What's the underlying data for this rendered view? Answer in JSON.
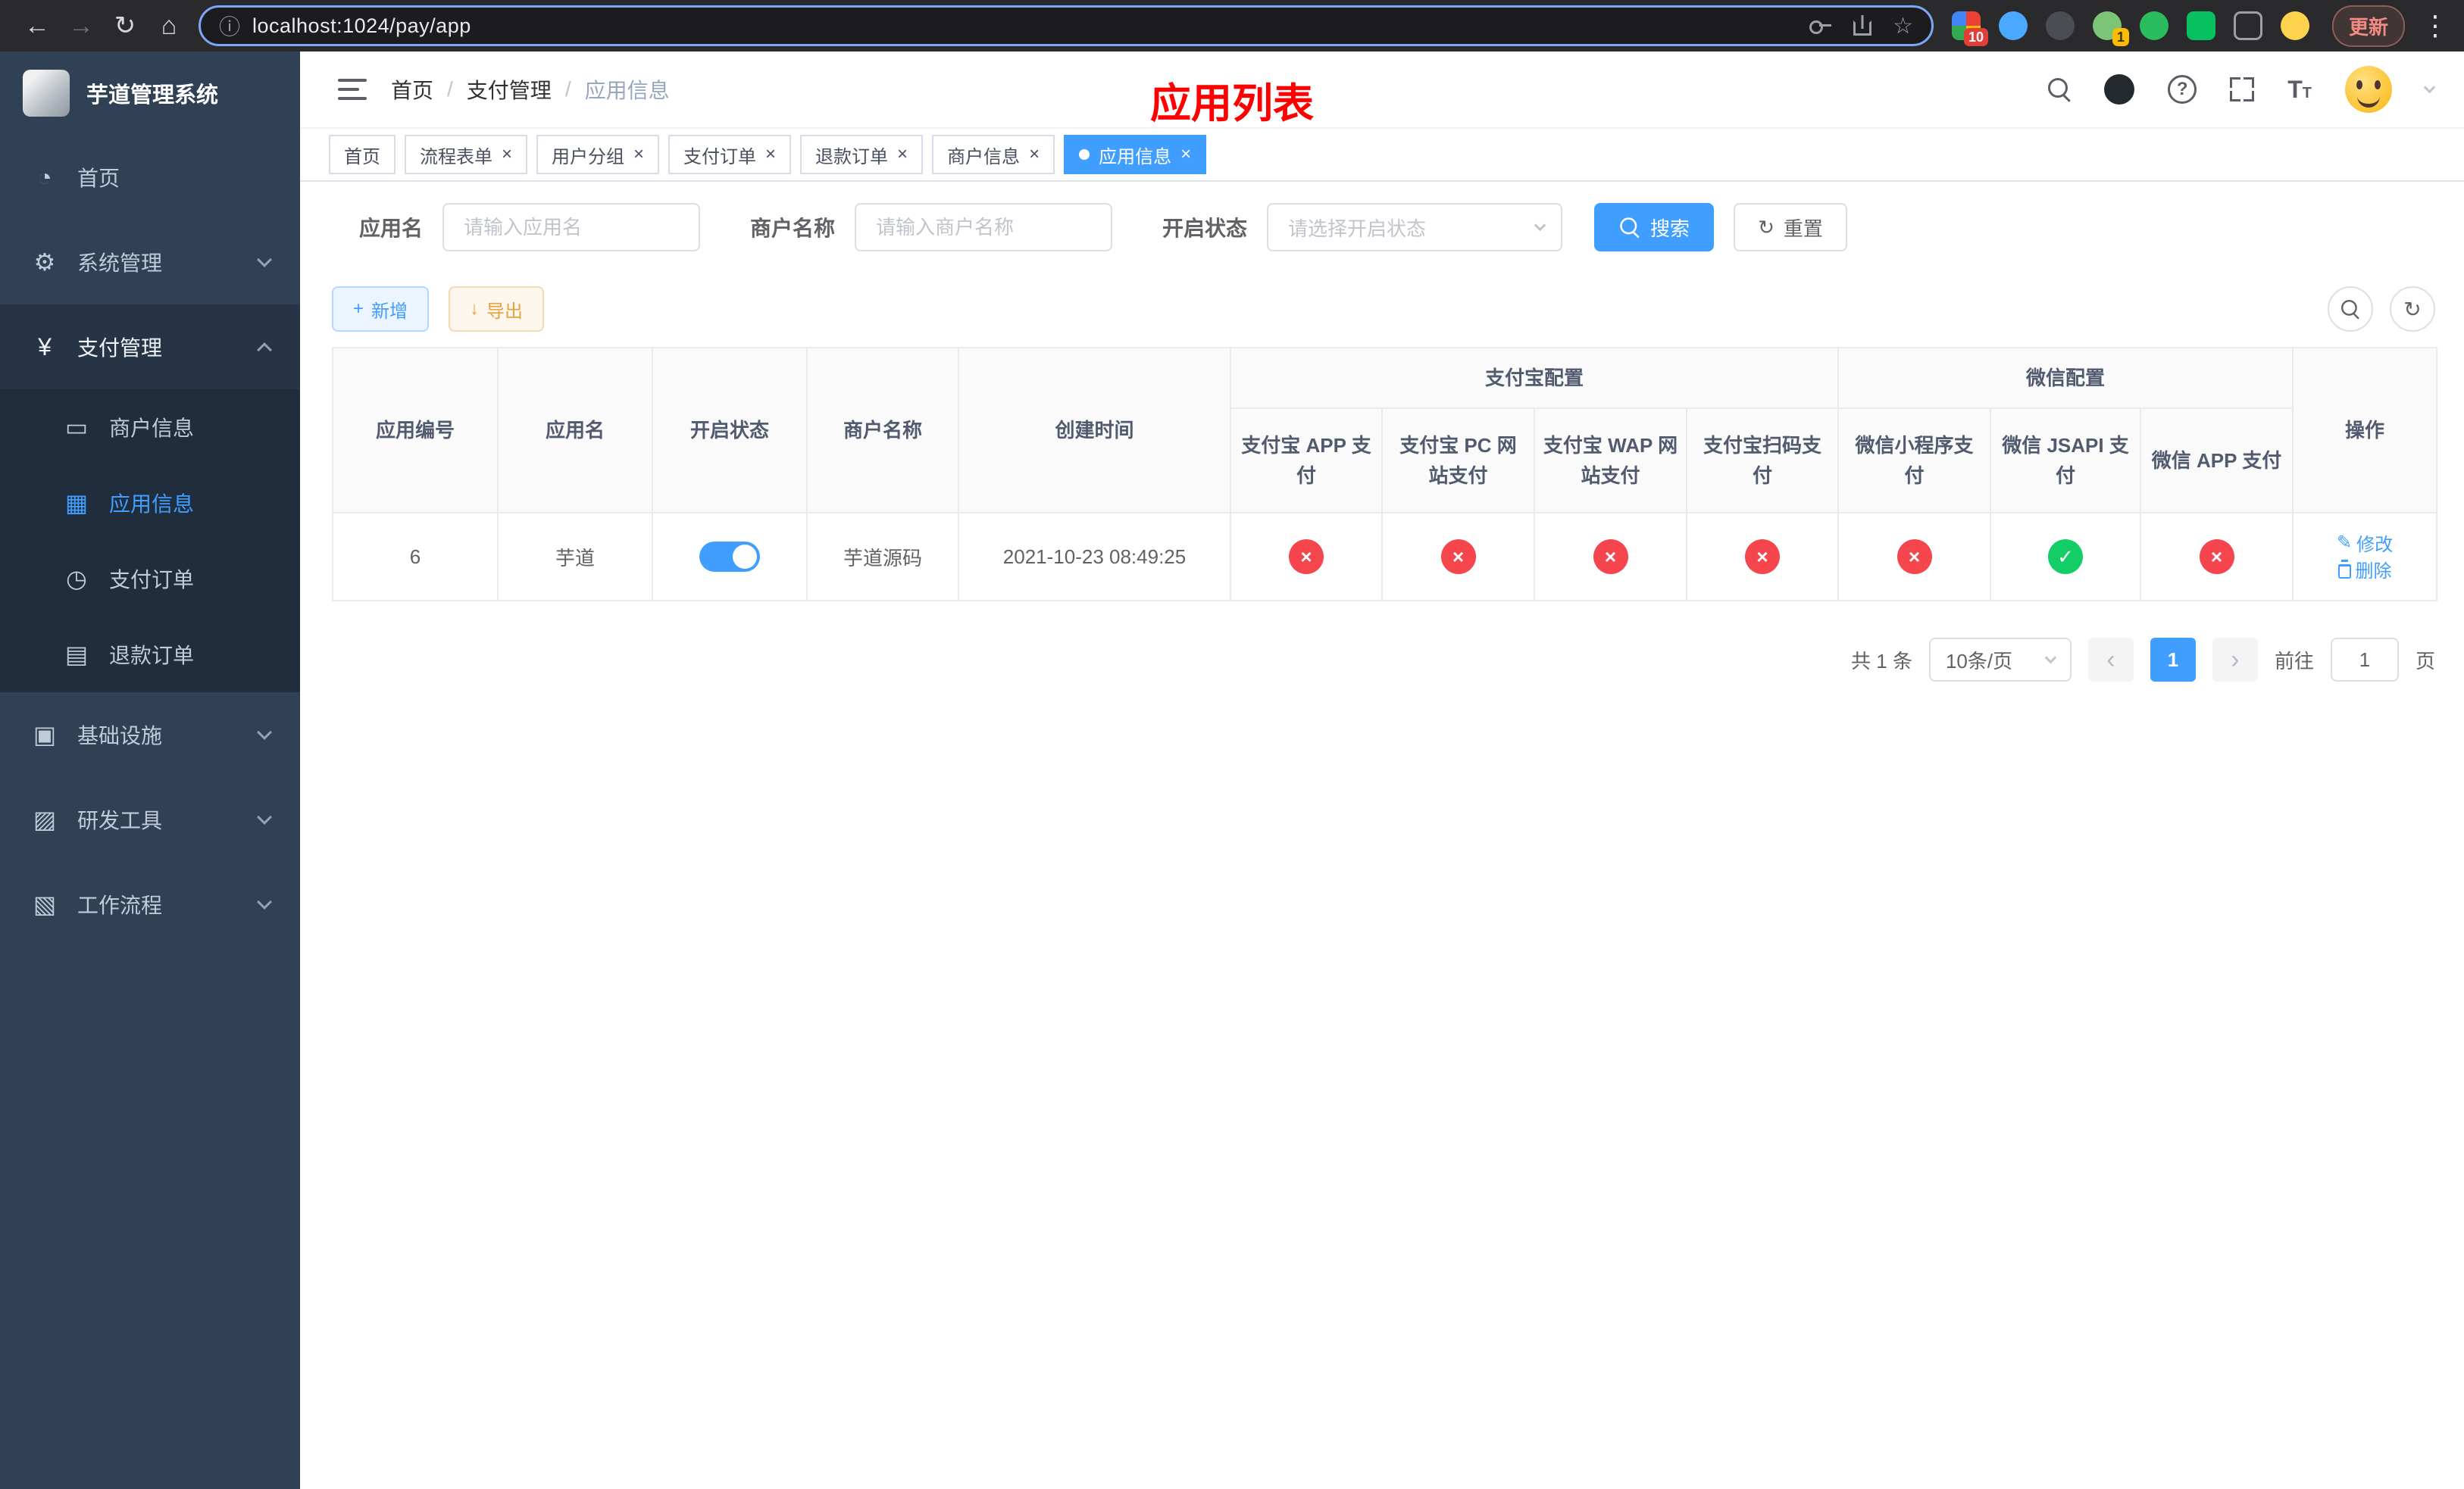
{
  "browser": {
    "url": "localhost:1024/pay/app",
    "update_label": "更新",
    "extension_badges": {
      "grid": "10",
      "avatar": "1"
    }
  },
  "icons": {
    "back": "←",
    "forward": "→",
    "reload": "↻",
    "home": "⌂",
    "site_info": "ⓘ",
    "star": "☆",
    "more": "⋮",
    "close": "×",
    "cross": "×",
    "check": "✓",
    "plus": "+",
    "download": "↓",
    "refresh": "↻",
    "question": "?",
    "edit": "✎",
    "prev": "‹",
    "next": "›",
    "font_size": "T",
    "dashboard": "◔",
    "gear": "⚙",
    "yen": "¥",
    "card": "▭",
    "grid": "▦",
    "order": "◷",
    "refund": "▤",
    "infra": "▣",
    "tools": "▨",
    "flow": "▧"
  },
  "sidebar": {
    "app_title": "芋道管理系统",
    "items": {
      "home": "首页",
      "system": "系统管理",
      "payment": "支付管理",
      "infra": "基础设施",
      "dev_tools": "研发工具",
      "workflow": "工作流程"
    },
    "payment_children": {
      "merchant": "商户信息",
      "app_info": "应用信息",
      "pay_order": "支付订单",
      "refund_order": "退款订单"
    }
  },
  "header": {
    "breadcrumb": {
      "home": "首页",
      "payment": "支付管理",
      "current": "应用信息",
      "separator": "/"
    },
    "overlay_title": "应用列表"
  },
  "tabs": [
    {
      "label": "首页",
      "closable": false,
      "active": false
    },
    {
      "label": "流程表单",
      "closable": true,
      "active": false
    },
    {
      "label": "用户分组",
      "closable": true,
      "active": false
    },
    {
      "label": "支付订单",
      "closable": true,
      "active": false
    },
    {
      "label": "退款订单",
      "closable": true,
      "active": false
    },
    {
      "label": "商户信息",
      "closable": true,
      "active": false
    },
    {
      "label": "应用信息",
      "closable": true,
      "active": true
    }
  ],
  "filters": {
    "app_name_label": "应用名",
    "app_name_placeholder": "请输入应用名",
    "merchant_name_label": "商户名称",
    "merchant_name_placeholder": "请输入商户名称",
    "status_label": "开启状态",
    "status_placeholder": "请选择开启状态",
    "search_label": "搜索",
    "reset_label": "重置"
  },
  "toolbar": {
    "add_label": "新增",
    "export_label": "导出"
  },
  "table": {
    "headers": {
      "app_id": "应用编号",
      "app_name": "应用名",
      "status": "开启状态",
      "merchant": "商户名称",
      "created": "创建时间",
      "alipay_group": "支付宝配置",
      "wechat_group": "微信配置",
      "alipay_app": "支付宝 APP 支付",
      "alipay_pc": "支付宝 PC 网站支付",
      "alipay_wap": "支付宝 WAP 网站支付",
      "alipay_qr": "支付宝扫码支付",
      "wechat_mini": "微信小程序支付",
      "wechat_jsapi": "微信 JSAPI 支付",
      "wechat_app": "微信 APP 支付",
      "actions": "操作"
    },
    "row": {
      "app_id": "6",
      "app_name": "芋道",
      "status_on": true,
      "merchant": "芋道源码",
      "created": "2021-10-23 08:49:25",
      "config": {
        "alipay_app": false,
        "alipay_pc": false,
        "alipay_wap": false,
        "alipay_qr": false,
        "wechat_mini": false,
        "wechat_jsapi": true,
        "wechat_app": false
      }
    }
  },
  "actions": {
    "edit_label": "修改",
    "delete_label": "删除"
  },
  "pagination": {
    "total": "共 1 条",
    "page_size": "10条/页",
    "current_page": "1",
    "goto_label": "前往",
    "goto_value": "1",
    "page_unit": "页"
  },
  "colors": {
    "primary": "#409eff",
    "danger": "#f5464d",
    "success": "#13ce66",
    "annotation_red": "#ff0000",
    "sidebar_bg": "#304156",
    "submenu_bg": "#1f2d3d"
  }
}
